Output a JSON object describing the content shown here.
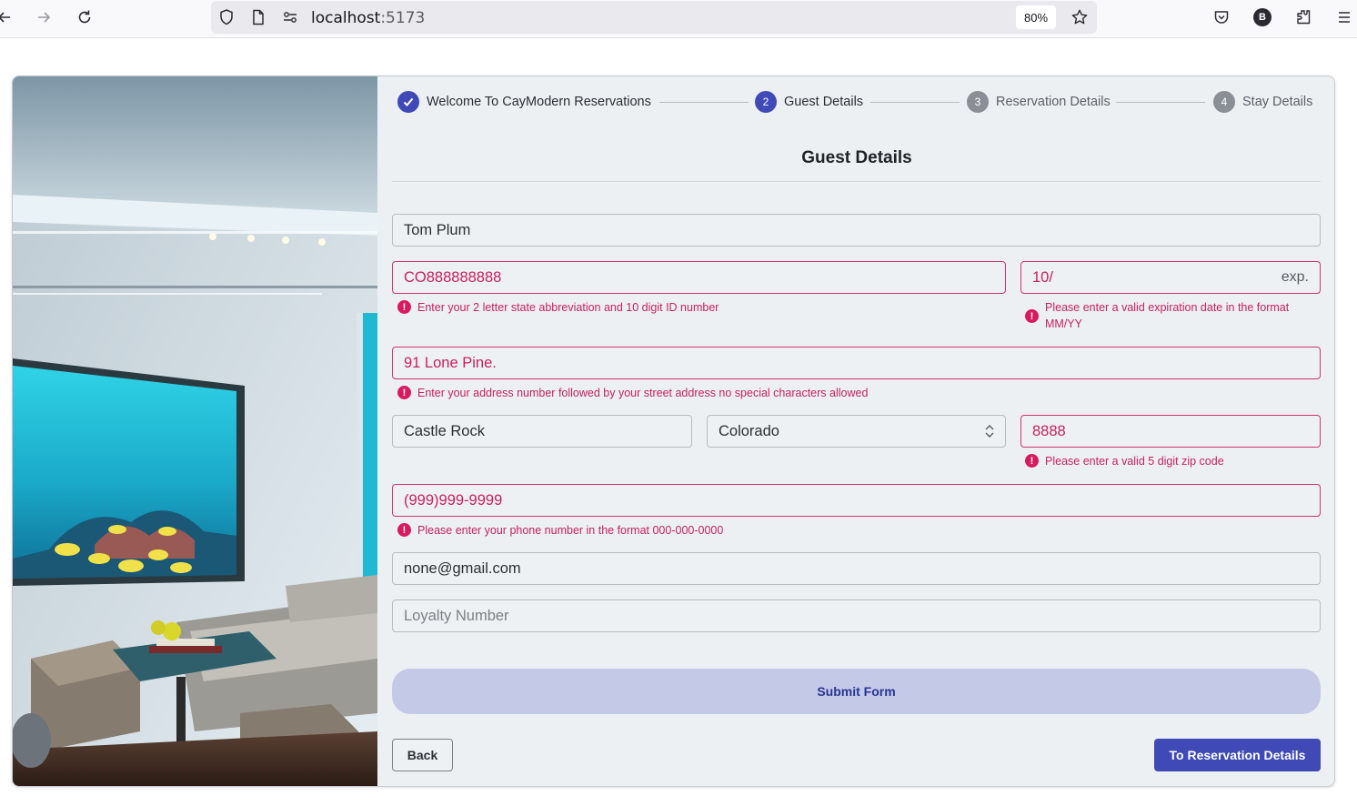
{
  "browser": {
    "url_host": "localhost",
    "url_port": ":5173",
    "zoom": "80%",
    "account_initial": "B"
  },
  "stepper": {
    "steps": [
      {
        "number": "1",
        "label": "Welcome To CayModern Reservations",
        "state": "done"
      },
      {
        "number": "2",
        "label": "Guest Details",
        "state": "active"
      },
      {
        "number": "3",
        "label": "Reservation Details",
        "state": "todo"
      },
      {
        "number": "4",
        "label": "Stay Details",
        "state": "todo"
      }
    ]
  },
  "form": {
    "title": "Guest Details",
    "name": {
      "value": "Tom Plum"
    },
    "id_number": {
      "value": "CO888888888",
      "error": "Enter your 2 letter state abbreviation and 10 digit ID number"
    },
    "expiration": {
      "value": "10/",
      "suffix": "exp.",
      "error": "Please enter a valid expiration date in the format MM/YY"
    },
    "address": {
      "value": "91 Lone Pine.",
      "error": "Enter your address number followed by your street address no special characters allowed"
    },
    "city": {
      "value": "Castle Rock"
    },
    "state": {
      "value": "Colorado"
    },
    "zip": {
      "value": "8888",
      "error": "Please enter a valid 5 digit zip code"
    },
    "phone": {
      "value": "(999)999-9999",
      "error": "Please enter your phone number in the format 000-000-0000"
    },
    "email": {
      "value": "none@gmail.com"
    },
    "loyalty": {
      "placeholder": "Loyalty Number"
    },
    "submit_label": "Submit Form",
    "back_label": "Back",
    "next_label": "To Reservation Details"
  },
  "colors": {
    "accent": "#3f4ab6",
    "error": "#c8215e",
    "submit_bg": "#c5c9e8"
  }
}
